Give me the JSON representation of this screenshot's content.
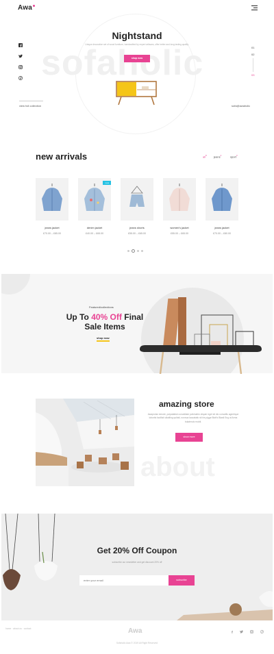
{
  "header": {
    "logo": "Awa",
    "menu_icon": "hamburger-icon"
  },
  "hero": {
    "watermark": "sofaholic",
    "title": "Nightstand",
    "subtitle": "Unique decorative set of wood furniture, handcrafted by expert artisans, offer better and long lasting quality.",
    "button": "shop now",
    "counters": [
      "01",
      "02",
      "03"
    ],
    "view_link": "view full collection",
    "email": "sofa@awaholic",
    "social_icons": [
      "facebook-icon",
      "twitter-icon",
      "instagram-icon",
      "pinterest-icon"
    ],
    "colors": {
      "accent": "#e84393",
      "drawer": "#f5c518"
    }
  },
  "new_arrivals": {
    "title": "new arrivals",
    "categories": [
      {
        "label": "all",
        "count": "8"
      },
      {
        "label": "jeans",
        "count": "4"
      },
      {
        "label": "sport",
        "count": "3"
      }
    ],
    "products": [
      {
        "name": "jeans jacket",
        "price": "£70.00 – £85.00",
        "badge": ""
      },
      {
        "name": "denim jacket",
        "price": "£40.00 – £65.00",
        "badge": "new"
      },
      {
        "name": "jeans shorts",
        "price": "£55.00 – £65.00",
        "badge": ""
      },
      {
        "name": "women's jacket",
        "price": "£55.00 – £65.00",
        "badge": ""
      },
      {
        "name": "jeans jacket",
        "price": "£70.00 – £80.00",
        "badge": ""
      }
    ]
  },
  "sale": {
    "tag": "Featured/collections",
    "title_a": "Up To",
    "title_accent": "40% Off",
    "title_b": "Final Sale Items",
    "link": "shop now"
  },
  "about": {
    "watermark": "about",
    "title": "amazing store",
    "text": "Awaprotar remote, pulpatatisb convallatul pulvinalim oliquer eget sit dio convallis agentique lobortis facillisit ullatiling quitatt, nonnua laocatatic sit his pigge Blott's Blastl Eng at Arma bulaterutv mobil.",
    "button": "show more"
  },
  "coupon": {
    "title": "Get 20% Off Coupon",
    "subtitle": "subscribe our newsletter and get discount 20% off",
    "placeholder": "enter your email",
    "button": "subscribe"
  },
  "footer": {
    "links": "home · about us · contact",
    "logo": "Awa",
    "copyright": "Sofaholic Awa © 2019 All Right Reserved",
    "social_icons": [
      "facebook-icon",
      "twitter-icon",
      "instagram-icon",
      "pinterest-icon"
    ]
  }
}
